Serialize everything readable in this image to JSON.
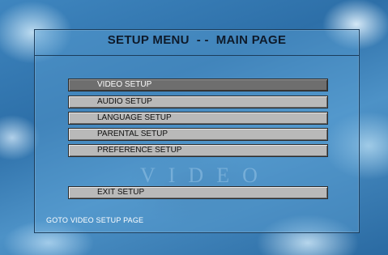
{
  "header": {
    "title": "SETUP MENU  - -  MAIN PAGE"
  },
  "watermark": "VIDEO",
  "menu": {
    "items": [
      {
        "label": "VIDEO SETUP",
        "selected": true
      },
      {
        "label": "AUDIO SETUP",
        "selected": false
      },
      {
        "label": "LANGUAGE SETUP",
        "selected": false
      },
      {
        "label": "PARENTAL SETUP",
        "selected": false
      },
      {
        "label": "PREFERENCE SETUP",
        "selected": false
      }
    ],
    "exit_label": "EXIT SETUP"
  },
  "status": {
    "text": "GOTO VIDEO SETUP PAGE"
  },
  "colors": {
    "background": "#3a7fb8",
    "selected_item": "#6e6e6e",
    "item": "#b9b9b9",
    "title_text": "#0e1a2a"
  }
}
